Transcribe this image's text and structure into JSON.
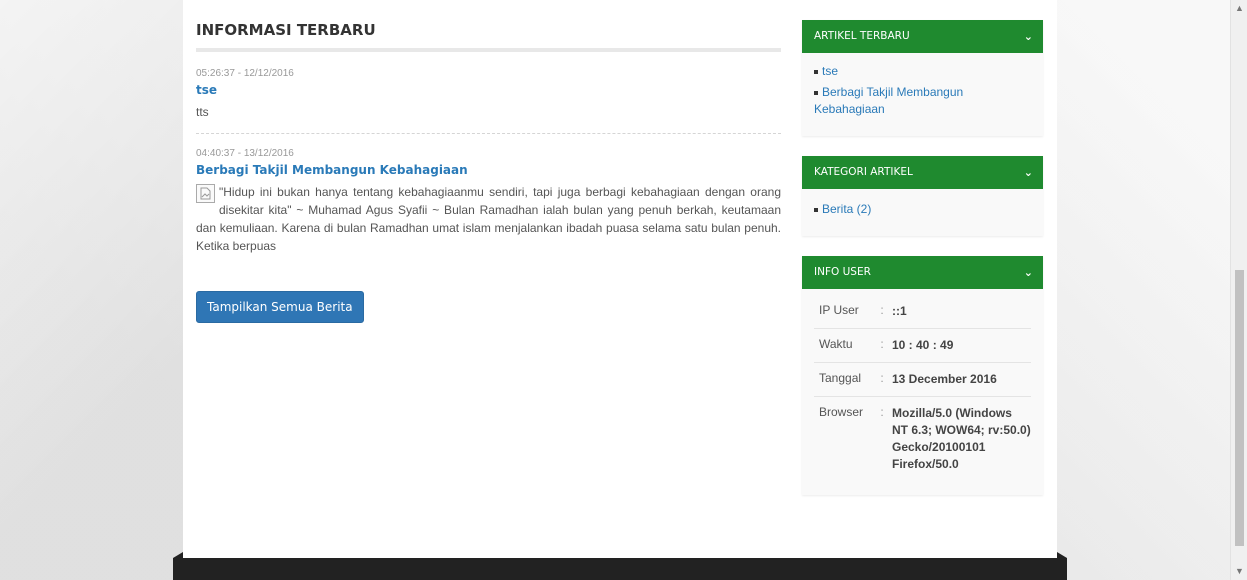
{
  "main": {
    "section_title": "INFORMASI TERBARU",
    "news": [
      {
        "date": "05:26:37 - 12/12/2016",
        "title": "tse",
        "body": "tts"
      },
      {
        "date": "04:40:37 - 13/12/2016",
        "title": "Berbagi Takjil Membangun Kebahagiaan",
        "body": "\"Hidup ini bukan hanya tentang kebahagiaanmu sendiri, tapi juga berbagi kebahagiaan dengan orang disekitar kita\" ~ Muhamad Agus Syafii ~ Bulan Ramadhan ialah bulan yang penuh berkah, keutamaan dan kemuliaan. Karena di bulan Ramadhan umat islam menjalankan ibadah puasa selama satu bulan penuh. Ketika berpuas"
      }
    ],
    "show_all_label": "Tampilkan Semua Berita"
  },
  "sidebar": {
    "articles": {
      "title": "ARTIKEL TERBARU",
      "items": [
        "tse",
        "Berbagi Takjil Membangun Kebahagiaan"
      ]
    },
    "categories": {
      "title": "KATEGORI ARTIKEL",
      "items": [
        "Berita (2)"
      ]
    },
    "user_info": {
      "title": "INFO USER",
      "separator": ":",
      "rows": [
        {
          "key": "IP User",
          "value": "::1"
        },
        {
          "key": "Waktu",
          "value": "10 : 40 : 49"
        },
        {
          "key": "Tanggal",
          "value": "13 December 2016"
        },
        {
          "key": "Browser",
          "value": "Mozilla/5.0 (Windows NT 6.3; WOW64; rv:50.0) Gecko/20100101 Firefox/50.0"
        }
      ]
    }
  },
  "colors": {
    "widget_header": "#1f8a2f",
    "link": "#2a7ab8",
    "button": "#2f76b5"
  },
  "icons": {
    "widget_toggle": "chevron-down-icon",
    "thumbnail": "broken-image-icon"
  }
}
